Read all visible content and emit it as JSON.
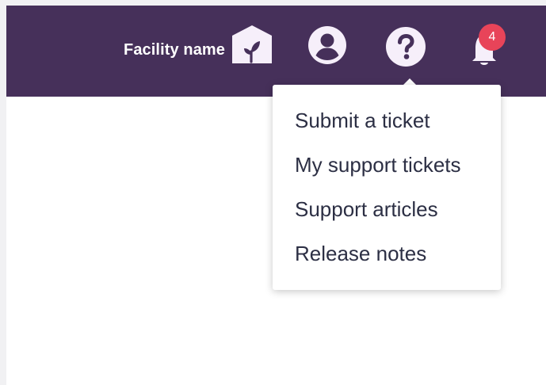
{
  "header": {
    "facility_name": "Facility name",
    "notification_count": "4",
    "icons": [
      "home-plant-icon",
      "account-circle-icon",
      "help-icon",
      "bell-icon"
    ]
  },
  "help_menu": {
    "items": [
      {
        "label": "Submit a ticket"
      },
      {
        "label": "My support tickets"
      },
      {
        "label": "Support articles"
      },
      {
        "label": "Release notes"
      }
    ]
  },
  "colors": {
    "header_bg": "#46305a",
    "icon_fill": "#f6effa",
    "badge": "#e84459",
    "menu_text": "#2c2f44"
  }
}
